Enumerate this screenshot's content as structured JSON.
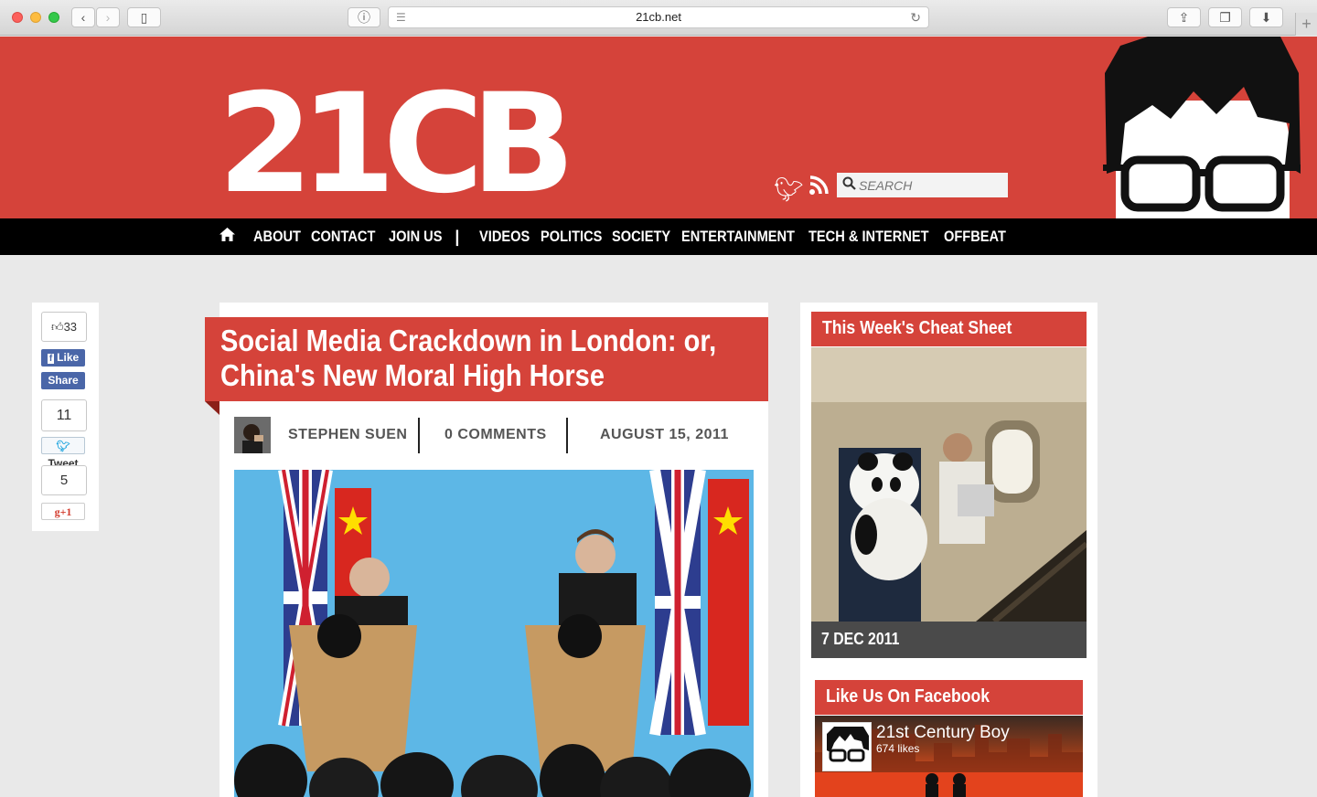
{
  "browser": {
    "url": "21cb.net",
    "new_tab_symbol": "+"
  },
  "header": {
    "logo_text": "21CB",
    "search_placeholder": "SEARCH",
    "brand_color": "#d5433a"
  },
  "nav": {
    "items": [
      "ABOUT",
      "CONTACT",
      "JOIN US",
      "|",
      "VIDEOS",
      "POLITICS",
      "SOCIETY",
      "ENTERTAINMENT",
      "TECH & INTERNET",
      "OFFBEAT"
    ]
  },
  "share": {
    "fb_count": "33",
    "fb_like": "Like",
    "fb_share": "Share",
    "tweet_count": "11",
    "tweet_label": "Tweet",
    "gplus_count": "5",
    "gplus_label": "+1"
  },
  "article": {
    "title_line1": "Social Media Crackdown in London: or,",
    "title_line2": "China's New Moral High Horse",
    "author": "STEPHEN SUEN",
    "comments": "0 COMMENTS",
    "date": "AUGUST 15, 2011"
  },
  "sidebar": {
    "cheat_sheet_title": "This Week's Cheat Sheet",
    "cheat_sheet_date": "7 DEC 2011",
    "facebook_title": "Like Us On Facebook",
    "facebook_page_name": "21st Century Boy",
    "facebook_likes": "674 likes"
  }
}
